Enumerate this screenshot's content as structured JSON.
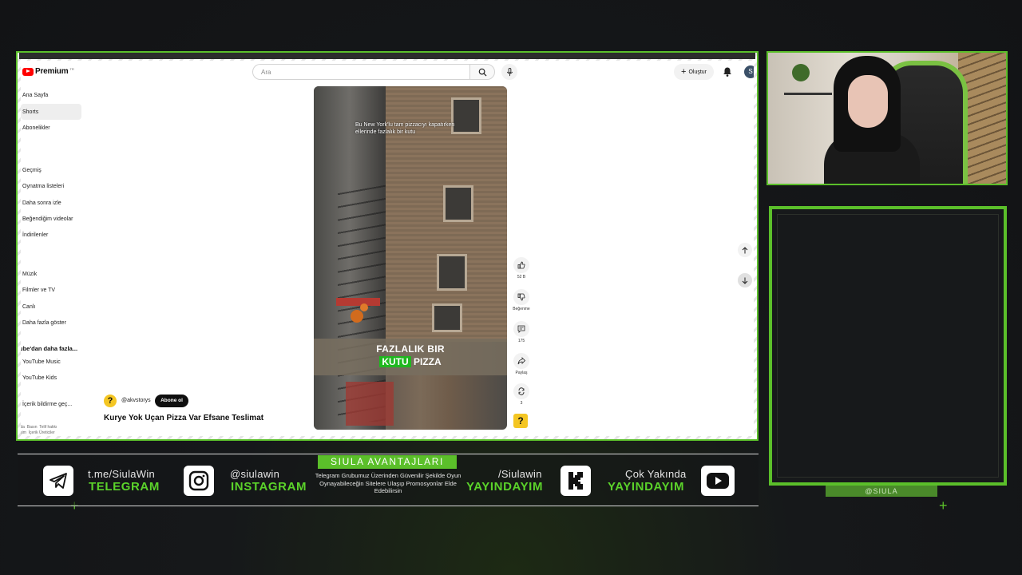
{
  "youtube": {
    "brand": "Premium",
    "region": "TR",
    "search_placeholder": "Ara",
    "create_label": "Oluştur",
    "avatar_letter": "S",
    "sidebar": {
      "main": [
        "Ana Sayfa",
        "Shorts",
        "Abonelikler"
      ],
      "you": [
        "Geçmiş",
        "Oynatma listeleri",
        "Daha sonra izle",
        "Beğendiğim videolar",
        "İndirilenler"
      ],
      "explore": [
        "Müzik",
        "Filmler ve TV",
        "Canlı",
        "Daha fazla göster"
      ],
      "more_head": "ube'dan daha fazla...",
      "more": [
        "YouTube Music",
        "YouTube Kids"
      ],
      "report": "İçerik bildirme geç...",
      "footer": "ıda  Basın  Telif hakkı\nişim  İçerik Üreticiler"
    },
    "short": {
      "caption": "Bu New York'lu tam pizzacıyı kapatırken ellerinde fazlalık bir kutu",
      "banner_line1": "FAZLALIK BIR",
      "banner_green": "KUTU",
      "banner_rest": "PIZZA",
      "channel_avatar": "?",
      "channel": "@akvstorys",
      "subscribe": "Abone ol",
      "title": "Kurye Yok Uçan Pizza Var Efsane Teslimat"
    },
    "actions": {
      "likes": "52 B",
      "dislike": "Beğenme",
      "comments": "175",
      "share": "Paylaş",
      "remix": "3",
      "thumb": "?"
    }
  },
  "overlay": {
    "tag": "@SIULA",
    "advantages_title": "SIULA AVANTAJLARI",
    "advantages_text": "Telegram Grubumuz Üzerinden Güvenilir Şekilde Oyun Oynayabileceğin Sitelere Ulaşıp Promosyonlar Elde Edebilirsin",
    "telegram_top": "t.me/SiulaWin",
    "telegram_bottom": "TELEGRAM",
    "instagram_top": "@siulawin",
    "instagram_bottom": "INSTAGRAM",
    "kick_top": "/Siulawin",
    "kick_bottom": "YAYINDAYIM",
    "youtube_top": "Çok Yakında",
    "youtube_bottom": "YAYINDAYIM",
    "accent_color": "#5bbf2a"
  }
}
